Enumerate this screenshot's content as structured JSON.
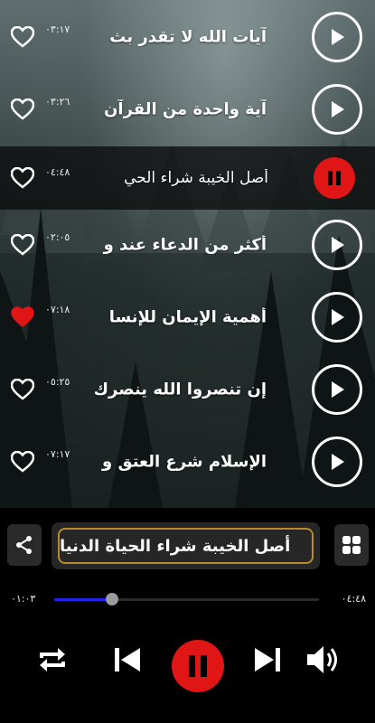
{
  "tracks": [
    {
      "title": "آيات الله لا تقدر بث",
      "duration": "٠٣:١٧",
      "favorite": false,
      "playing": false
    },
    {
      "title": "آية واحدة من القرآن",
      "duration": "٠٣:٢٦",
      "favorite": false,
      "playing": false
    },
    {
      "title": "أصل الخيبة شراء الحي",
      "duration": "٠٤:٤٨",
      "favorite": false,
      "playing": true
    },
    {
      "title": "أكثر من الدعاء عند و",
      "duration": "٠٢:٠٥",
      "favorite": false,
      "playing": false
    },
    {
      "title": "أهمية الإيمان للإنسا",
      "duration": "٠٧:١٨",
      "favorite": true,
      "playing": false
    },
    {
      "title": "إن تنصروا الله ينصرك",
      "duration": "٠٥:٢٥",
      "favorite": false,
      "playing": false
    },
    {
      "title": "الإسلام شرع العتق و",
      "duration": "٠٧:١٧",
      "favorite": false,
      "playing": false
    }
  ],
  "player": {
    "now_playing": "أصل الخيبة شراء الحياة الدنيا",
    "elapsed": "٠١:٠٣",
    "total": "٠٤:٤٨",
    "progress": 0.22
  },
  "colors": {
    "accent_red": "#e01515",
    "progress_blue": "#2222ee",
    "title_border": "#b88a30"
  },
  "icons": {
    "play": "play-icon",
    "pause": "pause-icon",
    "heart": "heart-icon",
    "share": "share-icon",
    "grid": "grid-icon",
    "repeat": "repeat-icon",
    "previous": "skip-previous-icon",
    "next": "skip-next-icon",
    "volume": "volume-icon"
  }
}
